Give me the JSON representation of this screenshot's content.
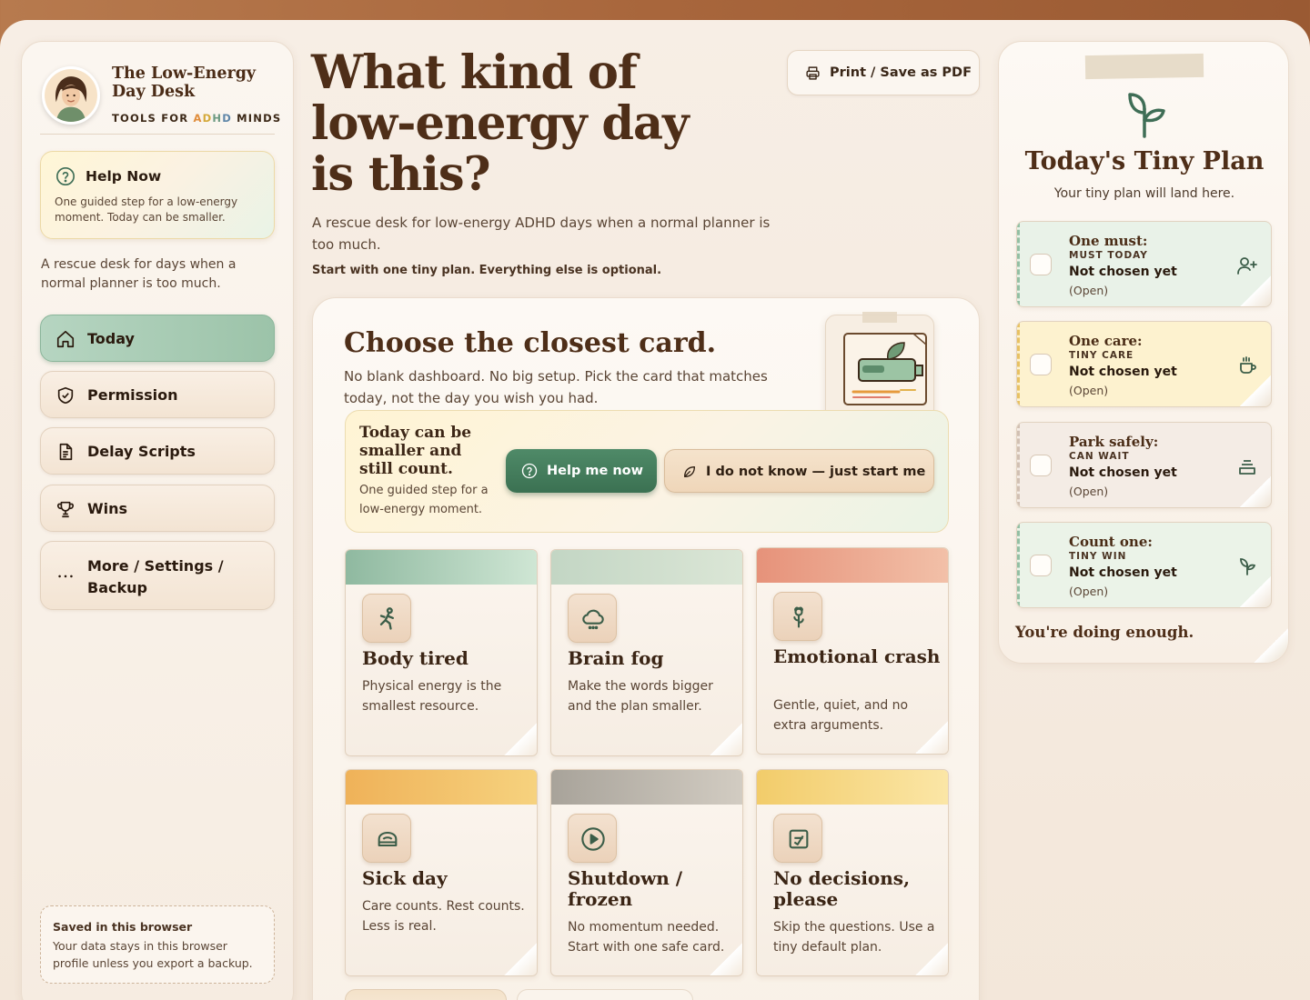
{
  "brand": {
    "title": "The Low-Energy Day Desk",
    "subtitle_prefix": "TOOLS FOR ",
    "subtitle_a": "A",
    "subtitle_d": "D",
    "subtitle_h": "H",
    "subtitle_d2": "D",
    "subtitle_suffix": " MINDS"
  },
  "help_now": {
    "title": "Help Now",
    "text": "One guided step for a low-energy moment. Today can be smaller."
  },
  "sidebar": {
    "description": "A rescue desk for days when a normal planner is too much.",
    "nav": [
      {
        "label": "Today",
        "icon": "home-icon",
        "active": true
      },
      {
        "label": "Permission",
        "icon": "shield-check-icon",
        "active": false
      },
      {
        "label": "Delay Scripts",
        "icon": "document-icon",
        "active": false
      },
      {
        "label": "Wins",
        "icon": "trophy-icon",
        "active": false
      },
      {
        "label": "More / Settings / Backup",
        "icon": "ellipsis-icon",
        "active": false
      }
    ],
    "saved": {
      "title": "Saved in this browser",
      "text": "Your data stays in this browser profile unless you export a backup."
    }
  },
  "main": {
    "headline": "What kind of low-energy day is this?",
    "intro": "A rescue desk for low-energy ADHD days when a normal planner is too much.",
    "intro_bold": "Start with one tiny plan. Everything else is optional.",
    "print_label": "Print / Save as PDF"
  },
  "cards_panel": {
    "title": "Choose the closest card.",
    "description": "No blank dashboard. No big setup. Pick the card that matches today, not the day you wish you had.",
    "smaller": {
      "title": "Today can be smaller and still count.",
      "text": "One guided step for a low-energy moment.",
      "help_button": "Help me now",
      "start_button": "I do not know — just start me"
    },
    "cards": [
      {
        "title": "Body tired",
        "text": "Physical energy is the smallest resource.",
        "icon": "walking-person-icon",
        "band": [
          "#8fb9a0",
          "#cfe6d4"
        ]
      },
      {
        "title": "Brain fog",
        "text": "Make the words bigger and the plan smaller.",
        "icon": "cloud-icon",
        "band": [
          "#c3d6c4",
          "#dbe6d6"
        ]
      },
      {
        "title": "Emotional crash",
        "text": "Gentle, quiet, and no extra arguments.",
        "icon": "flower-icon",
        "band": [
          "#e6927a",
          "#f2c0a8"
        ]
      },
      {
        "title": "Sick day",
        "text": "Care counts. Rest counts. Less is real.",
        "icon": "bed-icon",
        "band": [
          "#efb259",
          "#f6d27e"
        ]
      },
      {
        "title": "Shutdown / frozen",
        "text": "No momentum needed. Start with one safe card.",
        "icon": "play-icon",
        "band": [
          "#a8a39a",
          "#d2ccc2"
        ]
      },
      {
        "title": "No decisions, please",
        "text": "Skip the questions. Use a tiny default plan.",
        "icon": "checkbox-edit-icon",
        "band": [
          "#f2cc6a",
          "#fbe6a6"
        ]
      }
    ]
  },
  "plan": {
    "title": "Today's Tiny Plan",
    "subtitle": "Your tiny plan will land here.",
    "slots": [
      {
        "title": "One must:",
        "tag": "MUST TODAY",
        "value": "Not chosen yet",
        "state": "(Open)",
        "icon": "add-person-icon",
        "bg": "#e9f2e8",
        "edge": "#93bfa3"
      },
      {
        "title": "One care:",
        "tag": "TINY CARE",
        "value": "Not chosen yet",
        "state": "(Open)",
        "icon": "cup-icon",
        "bg": "#fdf2cf",
        "edge": "#e8c163"
      },
      {
        "title": "Park safely:",
        "tag": "CAN WAIT",
        "value": "Not chosen yet",
        "state": "(Open)",
        "icon": "inbox-stack-icon",
        "bg": "#f4ece5",
        "edge": "#d1c0b3"
      },
      {
        "title": "Count one:",
        "tag": "TINY WIN",
        "value": "Not chosen yet",
        "state": "(Open)",
        "icon": "sprout-icon",
        "bg": "#ebf3e8",
        "edge": "#93bfa3"
      }
    ],
    "footer": "You're doing enough."
  }
}
